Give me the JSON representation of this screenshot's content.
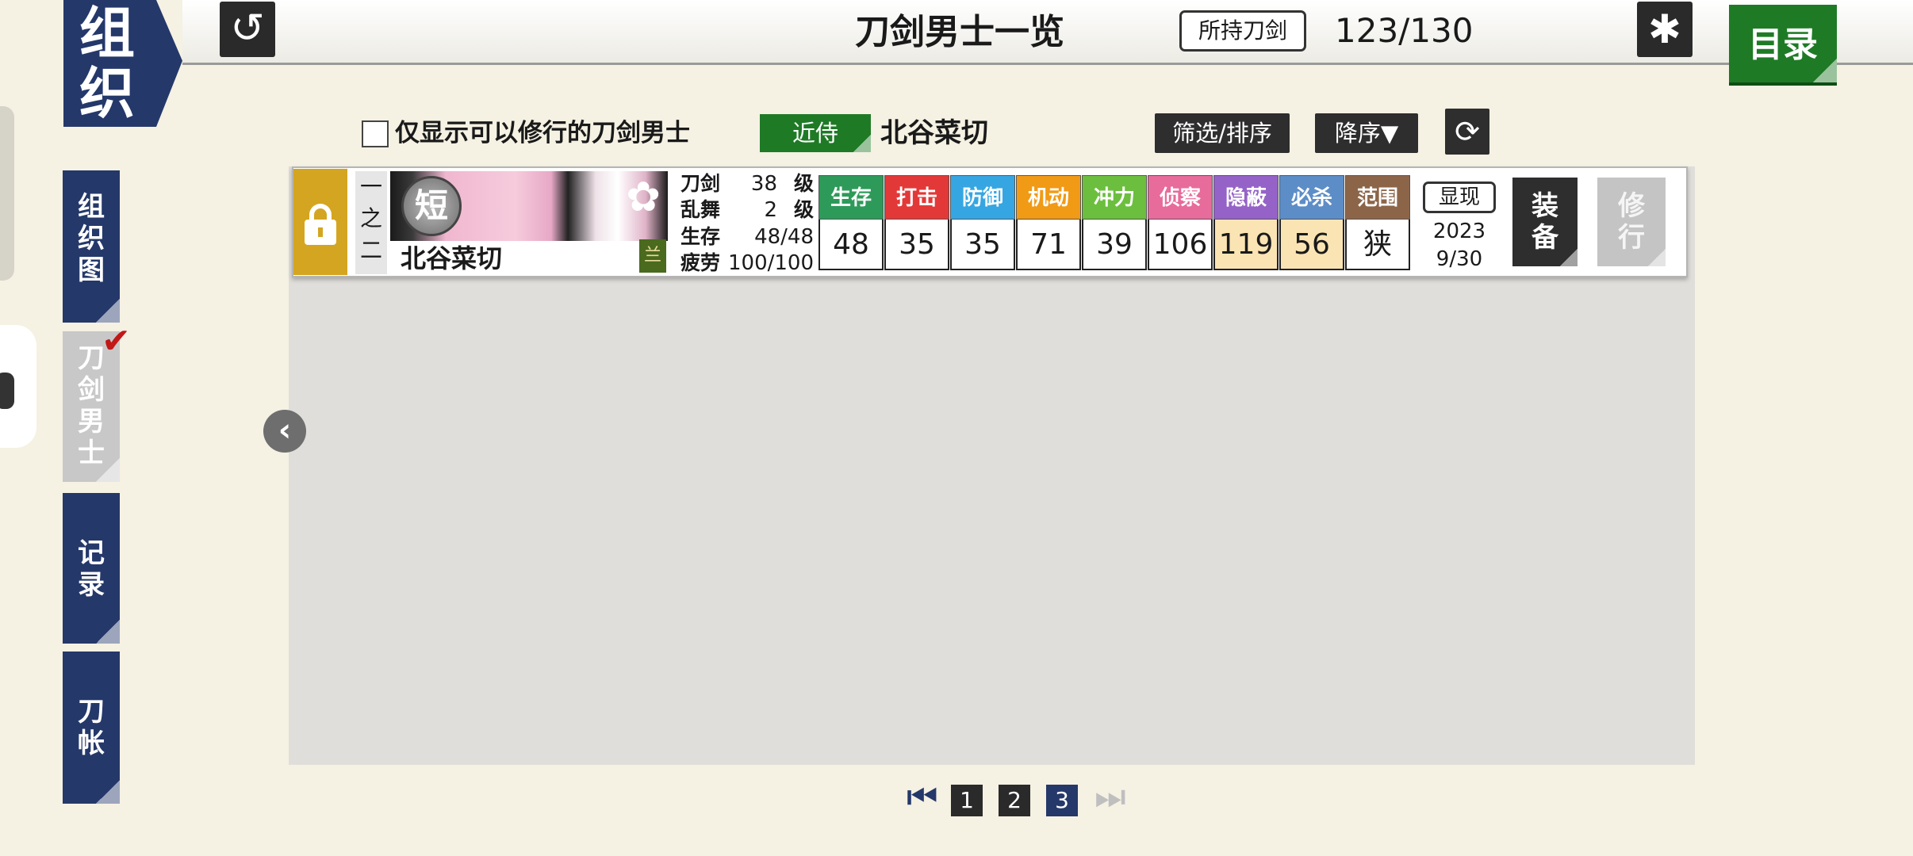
{
  "header": {
    "section_title": "组织",
    "page_title": "刀剑男士一览",
    "owned_label": "所持刀剑",
    "owned_count": "123/130",
    "menu_label": "目录",
    "back_icon": "↺",
    "gear_icon": "✱"
  },
  "sidebar": {
    "items": [
      {
        "label": "组织图",
        "active": false
      },
      {
        "label": "刀剑男士",
        "active": true
      },
      {
        "label": "记录",
        "active": false
      },
      {
        "label": "刀帐",
        "active": false
      }
    ],
    "check_icon": "✔"
  },
  "filter": {
    "checkbox_label": "仅显示可以修行的刀剑男士",
    "checkbox_checked": false,
    "attendant_label": "近侍",
    "attendant_name": "北谷菜切",
    "sort_button": "筛选/排序",
    "order_button": "降序▼",
    "refresh_icon": "⟳"
  },
  "sword": {
    "position": [
      "一",
      "之",
      "二"
    ],
    "type_badge": "短",
    "name": "北谷菜切",
    "rank_tag": "兰",
    "petal_icon": "✿",
    "levels": [
      {
        "label": "刀剑",
        "value": "38",
        "unit": "级"
      },
      {
        "label": "乱舞",
        "value": "2",
        "unit": "级"
      },
      {
        "label": "生存",
        "value": "48/48",
        "unit": ""
      },
      {
        "label": "疲劳",
        "value": "100/100",
        "unit": ""
      }
    ],
    "stats": [
      {
        "label": "生存",
        "value": "48",
        "color": "#2e9a5a",
        "highlight": false
      },
      {
        "label": "打击",
        "value": "35",
        "color": "#e33838",
        "highlight": false
      },
      {
        "label": "防御",
        "value": "35",
        "color": "#36a6e2",
        "highlight": false
      },
      {
        "label": "机动",
        "value": "71",
        "color": "#f19a16",
        "highlight": false
      },
      {
        "label": "冲力",
        "value": "39",
        "color": "#6cbf3e",
        "highlight": false
      },
      {
        "label": "侦察",
        "value": "106",
        "color": "#e76b9b",
        "highlight": false
      },
      {
        "label": "隐蔽",
        "value": "119",
        "color": "#9563c7",
        "highlight": true
      },
      {
        "label": "必杀",
        "value": "56",
        "color": "#5d8dc7",
        "highlight": true
      },
      {
        "label": "范围",
        "value": "狭",
        "color": "#8c6549",
        "highlight": false
      }
    ],
    "show_label": "显现",
    "date_year": "2023",
    "date_md": "9/30",
    "equip_label": [
      "装",
      "备"
    ],
    "train_label": [
      "修",
      "行"
    ]
  },
  "nav": {
    "prev_icon": "‹"
  },
  "pagination": {
    "first_icon": "⏮",
    "pages": [
      "1",
      "2",
      "3"
    ],
    "current": "3",
    "last_icon": "⏭"
  },
  "colors": {
    "navy": "#24386a",
    "green": "#1f7a26",
    "lock": "#d4a520"
  }
}
